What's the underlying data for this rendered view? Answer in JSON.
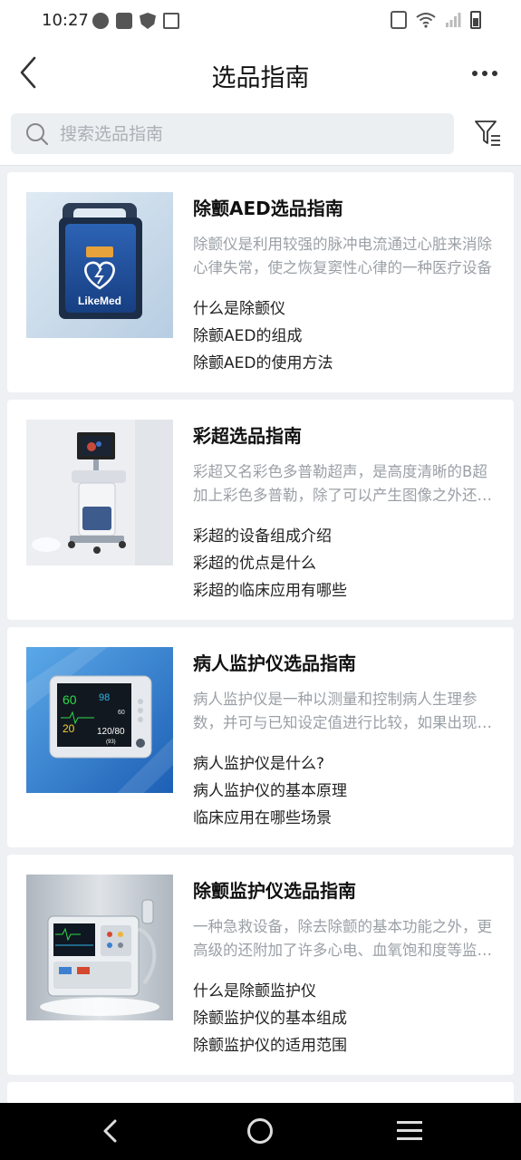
{
  "status_bar": {
    "time": "10:27",
    "left_icons": [
      "clock-app-icon",
      "mail-icon",
      "shield-icon",
      "calendar-icon"
    ],
    "right_icons": [
      "vibrate-icon",
      "wifi-icon",
      "signal-icon",
      "battery-icon"
    ]
  },
  "header": {
    "title": "选品指南",
    "back_icon": "chevron-left-icon",
    "more_icon": "more-dots-icon"
  },
  "search": {
    "placeholder": "搜索选品指南",
    "value": "",
    "filter_icon": "filter-icon"
  },
  "guides": [
    {
      "image": "aed-device-image",
      "image_brand_text": "LikeMed",
      "title": "除颤AED选品指南",
      "description": "除颤仪是利用较强的脉冲电流通过心脏来消除心律失常，使之恢复窦性心律的一种医疗设备",
      "links": [
        "什么是除颤仪",
        "除颤AED的组成",
        "除颤AED的使用方法"
      ]
    },
    {
      "image": "color-ultrasound-image",
      "title": "彩超选品指南",
      "description": "彩超又名彩色多普勒超声，是高度清晰的B超加上彩色多普勒，除了可以产生图像之外还能显示血流",
      "links": [
        "彩超的设备组成介绍",
        "彩超的优点是什么",
        "彩超的临床应用有哪些"
      ]
    },
    {
      "image": "patient-monitor-image",
      "image_screen_values": [
        "60",
        "98",
        "60",
        "20",
        "120/80",
        "(93)"
      ],
      "title": "病人监护仪选品指南",
      "description": "病人监护仪是一种以测量和控制病人生理参数，并可与已知设定值进行比较，如果出现超标可发出警报的装置",
      "links": [
        "病人监护仪是什么?",
        "病人监护仪的基本原理",
        "临床应用在哪些场景"
      ]
    },
    {
      "image": "defibrillator-monitor-image",
      "title": "除颤监护仪选品指南",
      "description": "一种急救设备，除去除颤的基本功能之外，更高级的还附加了许多心电、血氧饱和度等监护功能",
      "links": [
        "什么是除颤监护仪",
        "除颤监护仪的基本组成",
        "除颤监护仪的适用范围"
      ]
    }
  ],
  "nav_bar": {
    "back_icon": "nav-back-icon",
    "home_icon": "nav-home-icon",
    "recent_icon": "nav-recent-icon"
  }
}
